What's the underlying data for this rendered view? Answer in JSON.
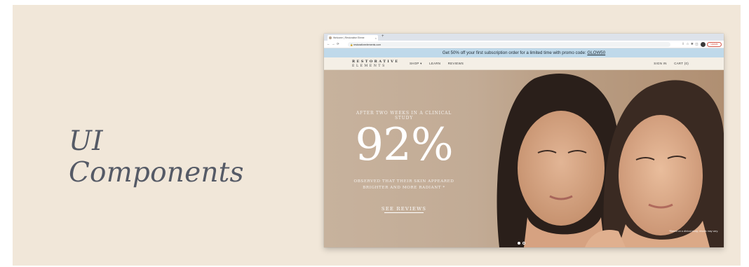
{
  "caption": "UI Components",
  "browser": {
    "tab_title": "Welcome | Restorative Eleme",
    "tab_close": "×",
    "new_tab": "+",
    "url": "restorativeelements.com",
    "update_label": "Update"
  },
  "promo": {
    "text": "Get 50% off your first subscription order for a limited time with promo code: ",
    "code": "GLOW50"
  },
  "site": {
    "logo_line1": "RESTORATIVE",
    "logo_line2": "ELEMENTS",
    "nav_shop": "SHOP ▾",
    "nav_learn": "LEARN",
    "nav_reviews": "REVIEWS",
    "sign_in": "SIGN IN",
    "cart": "CART (0)"
  },
  "hero": {
    "pretitle": "AFTER TWO WEEKS IN A CLINICAL STUDY",
    "stat": "92%",
    "subtitle": "OBSERVED THAT THEIR SKIN APPEARED BRIGHTER AND MORE RADIANT *",
    "cta": "SEE REVIEWS",
    "footnote": "*Based on a clinical study; results may vary.",
    "slides_total": 2,
    "slide_active": 1
  },
  "colors": {
    "card_bg": "#f1e7d9",
    "promo_bg": "#bfd9ea",
    "hero_bg": "#c2ab95",
    "update_accent": "#d65a4c"
  }
}
